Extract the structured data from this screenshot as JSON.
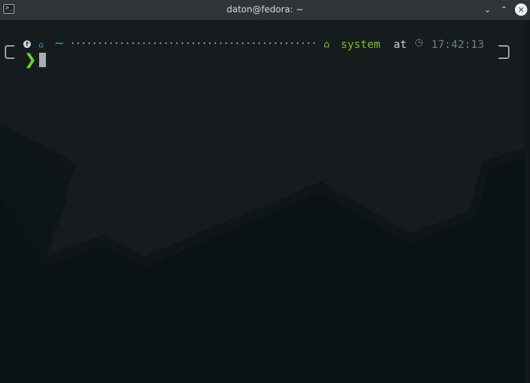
{
  "window": {
    "title": "daton@fedora: ~",
    "controls": [
      "minimize",
      "maximize",
      "close"
    ]
  },
  "prompt": {
    "distro_icon": "fedora-icon",
    "home_icon": "home-icon",
    "directory": "~",
    "separator": "dots",
    "system_icon": "system-icon",
    "system": "system",
    "at": "at",
    "clock_icon": "clock-icon",
    "time": "17:42:13",
    "input_symbol": "❯"
  },
  "colors": {
    "green": "#72c71d",
    "blue": "#2aa7df",
    "time": "#65818b",
    "background": "#0d1418"
  }
}
